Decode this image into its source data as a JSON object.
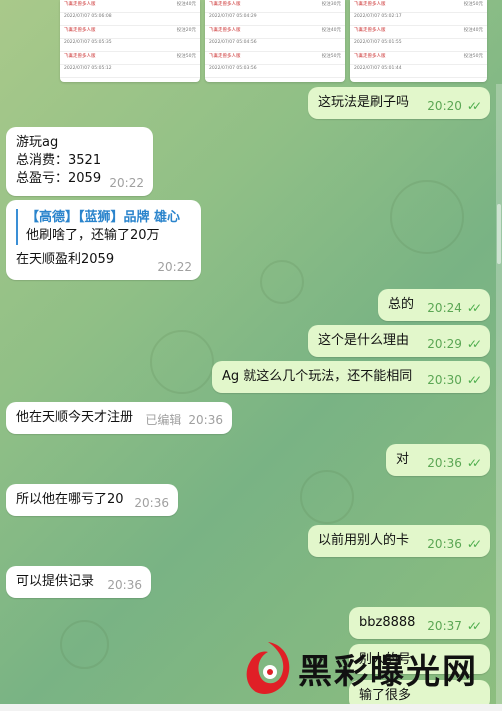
{
  "top_screenshots": [
    {
      "rows": [
        {
          "name": "飞禽走兽多人版",
          "amount": "投注40元",
          "time": "2022/07/07 05:06:08"
        },
        {
          "name": "飞禽走兽多人版",
          "amount": "投注20元",
          "time": "2022/07/07 05:05:35"
        },
        {
          "name": "飞禽走兽多人版",
          "amount": "投注50元",
          "time": "2022/07/07 05:05:12"
        }
      ]
    },
    {
      "rows": [
        {
          "name": "飞禽走兽多人版",
          "amount": "投注30元",
          "time": "2022/07/07 05:04:29"
        },
        {
          "name": "飞禽走兽多人版",
          "amount": "投注40元",
          "time": "2022/07/07 05:04:56"
        },
        {
          "name": "飞禽走兽多人版",
          "amount": "投注50元",
          "time": "2022/07/07 05:03:56"
        }
      ]
    },
    {
      "rows": [
        {
          "name": "飞禽走兽多人版",
          "amount": "投注50元",
          "time": "2022/07/07 05:02:17"
        },
        {
          "name": "飞禽走兽多人版",
          "amount": "投注40元",
          "time": "2022/07/07 05:01:55"
        },
        {
          "name": "飞禽走兽多人版",
          "amount": "投注50元",
          "time": "2022/07/07 05:01:44"
        }
      ]
    }
  ],
  "messages": {
    "m1": {
      "text": "这玩法是刷子吗",
      "time": "20:20"
    },
    "m2": {
      "lines": [
        "游玩ag",
        "总消费：3521",
        "总盈亏：2059"
      ],
      "time": "20:22"
    },
    "m3": {
      "reply_name": "【高德】【蓝狮】品牌 雄心",
      "reply_text": "他刷啥了，还输了20万",
      "text": "在天顺盈利2059",
      "time": "20:22"
    },
    "m4": {
      "text": "总的",
      "time": "20:24"
    },
    "m5": {
      "text": "这个是什么理由",
      "time": "20:29"
    },
    "m6": {
      "text": "Ag 就这么几个玩法，还不能相同",
      "time": "20:30"
    },
    "m7": {
      "text": "他在天顺今天才注册",
      "edited": "已编辑",
      "time": "20:36"
    },
    "m8": {
      "text": "对",
      "time": "20:36"
    },
    "m9": {
      "text": "所以他在哪亏了20",
      "time": "20:36"
    },
    "m10": {
      "text": "以前用别人的卡",
      "time": "20:36"
    },
    "m11": {
      "text": "可以提供记录",
      "time": "20:36"
    },
    "m12": {
      "text": "bbz8888",
      "time": "20:37"
    },
    "m13": {
      "text": "别人的号"
    },
    "m14": {
      "text": "输了很多"
    }
  },
  "watermark": {
    "text": "黑彩曝光网"
  },
  "colors": {
    "incoming": "#ffffff",
    "outgoing": "#e2f7cb",
    "check": "#4fae4e",
    "reply_accent": "#3a8fd6"
  }
}
